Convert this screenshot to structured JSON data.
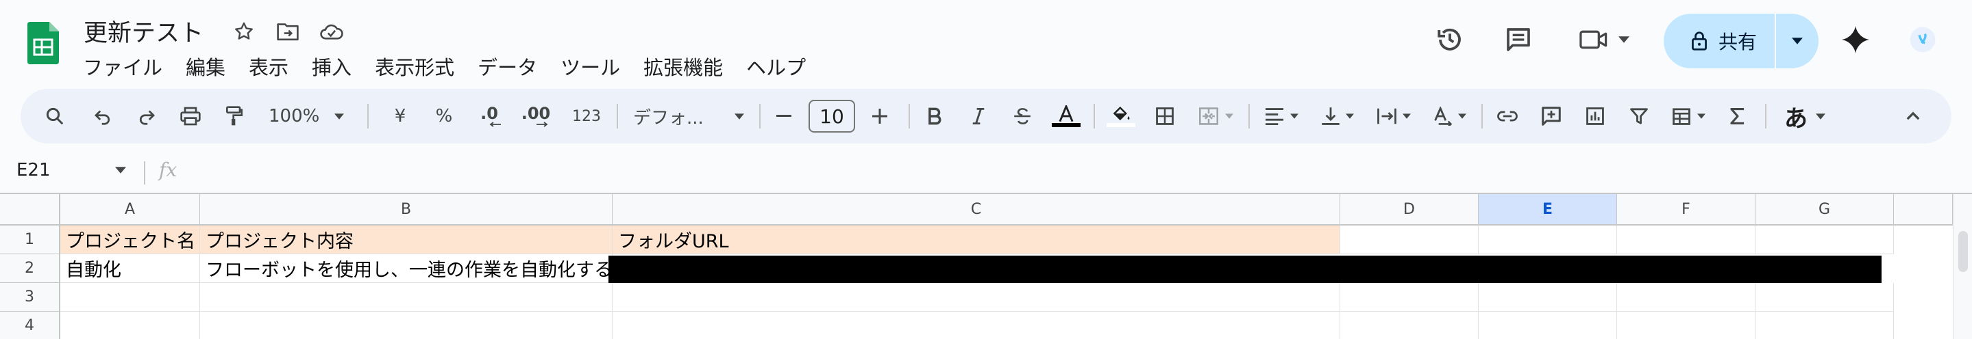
{
  "app": {
    "doc_title": "更新テスト",
    "menu": [
      "ファイル",
      "編集",
      "表示",
      "挿入",
      "表示形式",
      "データ",
      "ツール",
      "拡張機能",
      "ヘルプ"
    ],
    "share_label": "共有"
  },
  "toolbar": {
    "zoom": "100%",
    "currency": "¥",
    "percent": "%",
    "dec_decrease": ".0",
    "dec_increase": ".00",
    "number_format": "123",
    "font": "デフォ...",
    "font_size": "10",
    "ime_label": "あ"
  },
  "formula_bar": {
    "name_box": "E21",
    "fx_label": "fx"
  },
  "grid": {
    "columns": [
      "A",
      "B",
      "C",
      "D",
      "E",
      "F",
      "G"
    ],
    "selected_column": "E",
    "rows": [
      "1",
      "2",
      "3",
      "4"
    ],
    "cells": {
      "A1": "プロジェクト名",
      "B1": "プロジェクト内容",
      "C1": "フォルダURL",
      "A2": "自動化",
      "B2": "フローボットを使用し、一連の作業を自動化する"
    }
  },
  "colors": {
    "header_fill": "#fde5d1",
    "share_bg": "#c2e7ff",
    "selected_col": "#d3e3fd",
    "logo_green": "#0f9d58"
  },
  "icons": [
    "sheets-logo",
    "star-icon",
    "move-folder-icon",
    "cloud-status-icon",
    "history-icon",
    "comment-icon",
    "video-icon",
    "lock-icon",
    "gemini-icon",
    "account-avatar",
    "search-icon",
    "undo-icon",
    "redo-icon",
    "print-icon",
    "paint-format-icon",
    "bold-icon",
    "italic-icon",
    "strikethrough-icon",
    "text-color-icon",
    "fill-color-icon",
    "borders-icon",
    "merge-icon",
    "align-left-icon",
    "valign-icon",
    "wrap-icon",
    "rotate-icon",
    "link-icon",
    "comment-add-icon",
    "chart-icon",
    "filter-icon",
    "table-icon",
    "sum-icon",
    "collapse-icon"
  ]
}
